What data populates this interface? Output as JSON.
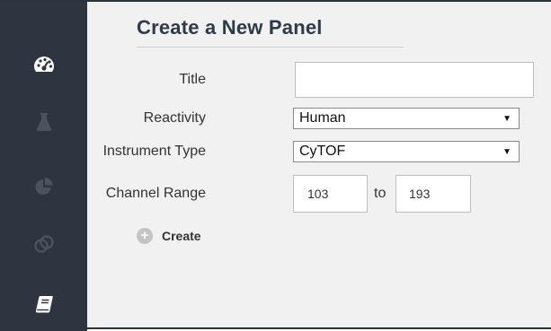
{
  "sidebar": {
    "items": [
      {
        "icon": "dashboard-icon"
      },
      {
        "icon": "flask-icon"
      },
      {
        "icon": "pie-chart-icon"
      },
      {
        "icon": "rings-icon"
      },
      {
        "icon": "book-icon"
      }
    ],
    "colors": {
      "background": "#2e3440",
      "active_icon": "#ffffff",
      "inactive_icon": "#4a525e"
    }
  },
  "panel_form": {
    "heading": "Create a New Panel",
    "title": {
      "label": "Title",
      "value": ""
    },
    "reactivity": {
      "label": "Reactivity",
      "selected": "Human"
    },
    "instrument_type": {
      "label": "Instrument Type",
      "selected": "CyTOF"
    },
    "channel_range": {
      "label": "Channel Range",
      "from": "103",
      "separator": "to",
      "to": "193"
    },
    "create_label": "Create"
  }
}
